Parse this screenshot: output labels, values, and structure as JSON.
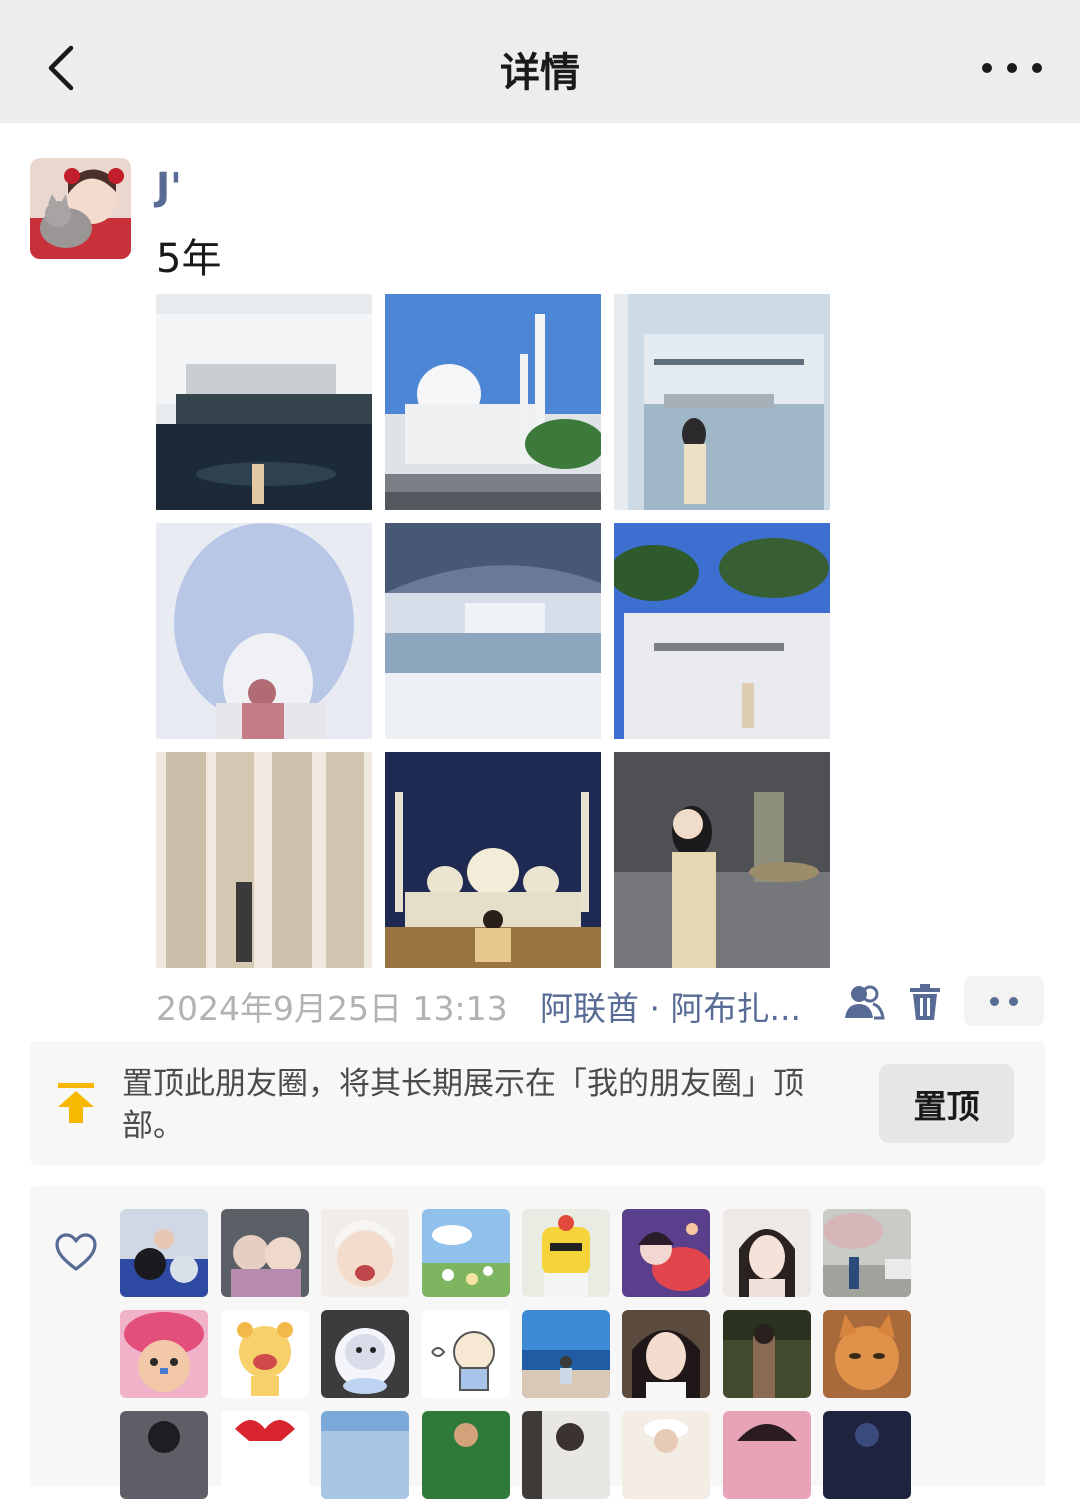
{
  "nav": {
    "title": "详情",
    "back_icon": "chevron-left-icon",
    "more_icon": "more-dots-icon"
  },
  "post": {
    "username": "J'",
    "text": "5年",
    "timestamp": "2024年9月25日 13:13",
    "location": "阿联酋 · 阿布扎...",
    "photo_count": 9
  },
  "pin": {
    "description": "置顶此朋友圈，将其长期展示在「我的朋友圈」顶部。",
    "button_label": "置顶"
  },
  "likes": {
    "icon": "heart-outline-icon",
    "avatars_visible": 24
  },
  "colors": {
    "nav_bg": "#ededed",
    "link": "#576b95",
    "pin_icon": "#f6b900",
    "muted": "#b2b2b2"
  }
}
